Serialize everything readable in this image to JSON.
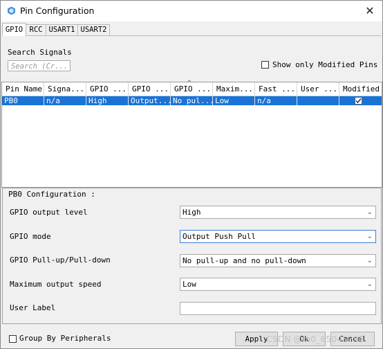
{
  "window": {
    "title": "Pin Configuration",
    "close_glyph": "✕",
    "app_icon": "stm32-cube-icon"
  },
  "tabs": [
    {
      "label": "GPIO",
      "active": true
    },
    {
      "label": "RCC",
      "active": false
    },
    {
      "label": "USART1",
      "active": false
    },
    {
      "label": "USART2",
      "active": false
    }
  ],
  "search": {
    "label": "Search Signals",
    "placeholder": "Search (Cr..."
  },
  "show_modified": {
    "label": "Show only Modified Pins",
    "checked": false
  },
  "table": {
    "columns": [
      "Pin Name",
      "Signa...",
      "GPIO ...",
      "GPIO ...",
      "GPIO ...",
      "Maxim...",
      "Fast ...",
      "User ...",
      "Modified"
    ],
    "rows": [
      {
        "cells": [
          "PB0",
          "n/a",
          "High",
          "Output...",
          "No pul...",
          "Low",
          "n/a",
          ""
        ],
        "modified": true,
        "selected": true
      }
    ]
  },
  "config": {
    "title": "PB0 Configuration :",
    "fields": [
      {
        "label": "GPIO output level",
        "value": "High"
      },
      {
        "label": "GPIO mode",
        "value": "Output Push Pull"
      },
      {
        "label": "GPIO Pull-up/Pull-down",
        "value": "No pull-up and no pull-down"
      },
      {
        "label": "Maximum output speed",
        "value": "Low"
      },
      {
        "label": "User Label",
        "value": ""
      }
    ]
  },
  "footer": {
    "group_by": {
      "label": "Group By Peripherals",
      "checked": false
    },
    "apply_label": "Apply",
    "ok_label": "Ok",
    "cancel_label": "Cancel"
  },
  "watermark": "CSDN @m0_65045295",
  "colors": {
    "selection": "#1a73d6",
    "background": "#f0f0f0"
  }
}
